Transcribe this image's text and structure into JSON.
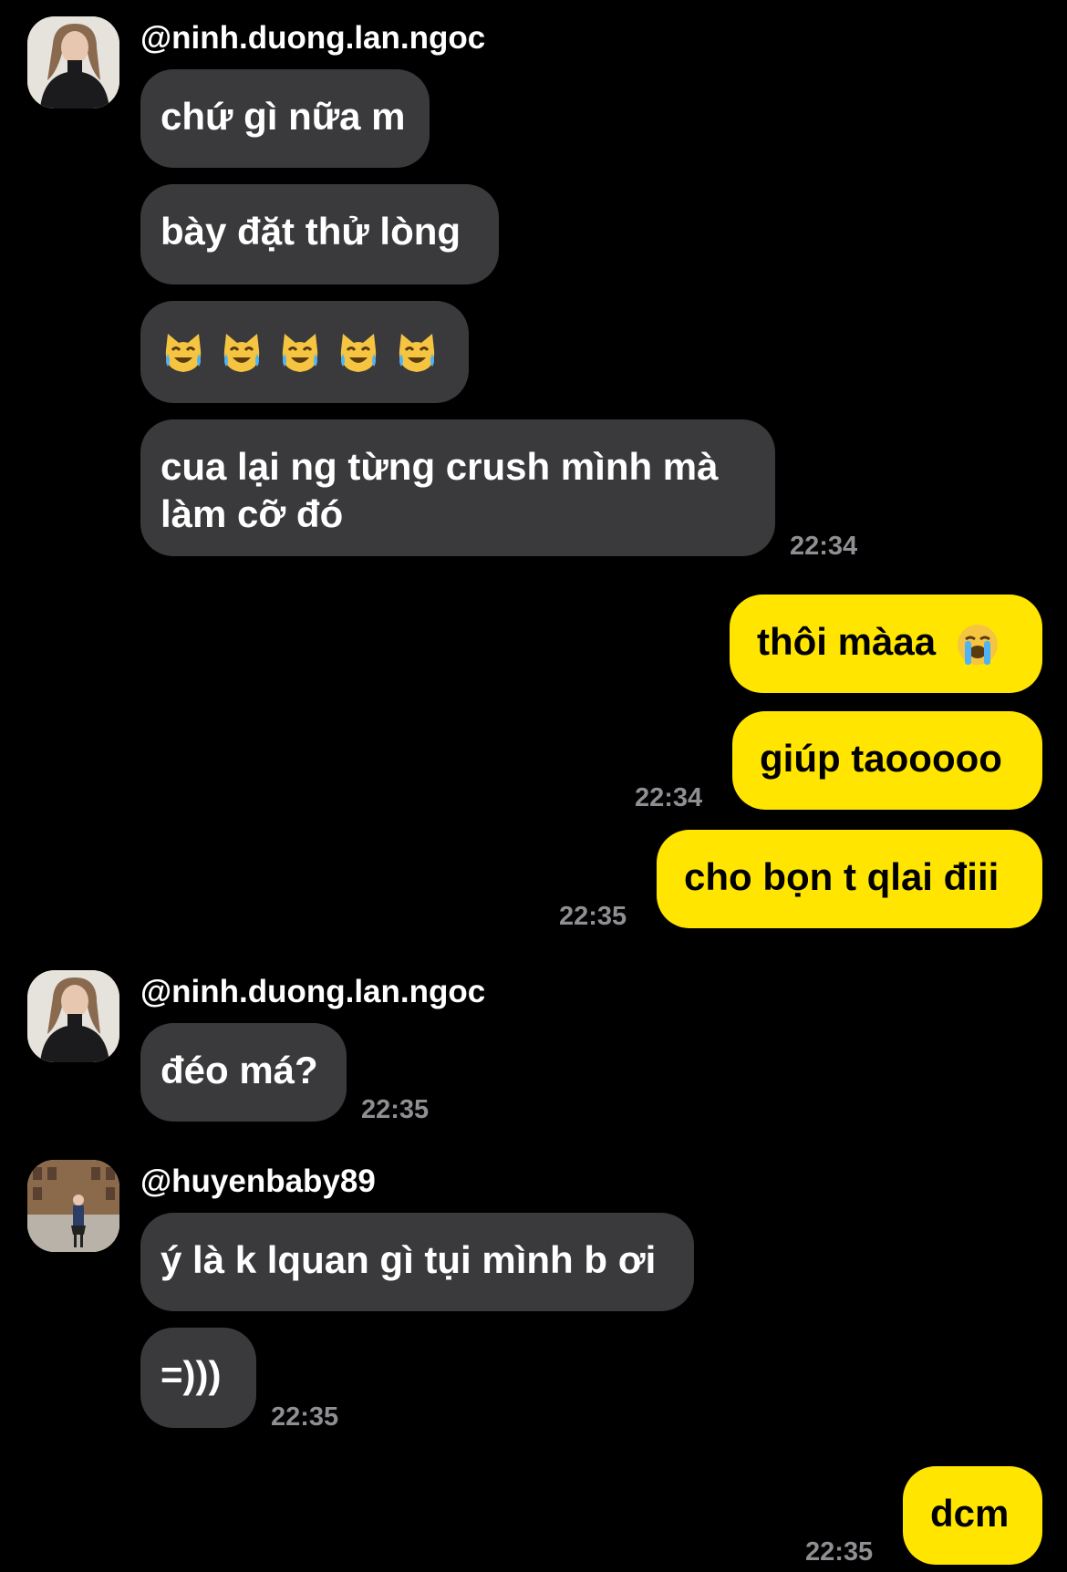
{
  "thread": [
    {
      "sender": "@ninh.duong.lan.ngoc",
      "messages": [
        "chứ gì nữa m",
        "bày đặt thử lòng",
        "😹😹😹😹😹",
        "cua lại ng từng crush mình mà làm cỡ đó"
      ],
      "line2": "làm cỡ đó",
      "line1": "cua lại ng từng crush mình mà",
      "time": "22:34"
    }
  ],
  "group1": {
    "username": "@ninh.duong.lan.ngoc",
    "msg1": "chứ gì nữa m",
    "msg2": "bày đặt thử lòng",
    "msg3_emoji": "crying-cat-face-emoji x5",
    "msg4_line1": "cua lại ng từng crush mình mà",
    "msg4_line2": "làm cỡ đó",
    "time": "22:34"
  },
  "me1": {
    "msg1": "thôi màaa",
    "msg1_emoji": "loudly-crying-face-emoji",
    "msg2": "giúp taooooo",
    "time2": "22:34",
    "msg3": "cho bọn t qlai điii",
    "time3": "22:35"
  },
  "group2": {
    "username": "@ninh.duong.lan.ngoc",
    "msg1": "đéo má?",
    "time": "22:35"
  },
  "group3": {
    "username": "@huyenbaby89",
    "msg1": "ý là k lquan gì tụi mình b ơi",
    "msg2": "=)))",
    "time": "22:35"
  },
  "me2": {
    "msg1": "dcm",
    "time": "22:35"
  },
  "colors": {
    "background": "#000000",
    "incoming_bubble": "#3a3a3c",
    "outgoing_bubble": "#ffe500",
    "timestamp": "#8e8e93"
  }
}
